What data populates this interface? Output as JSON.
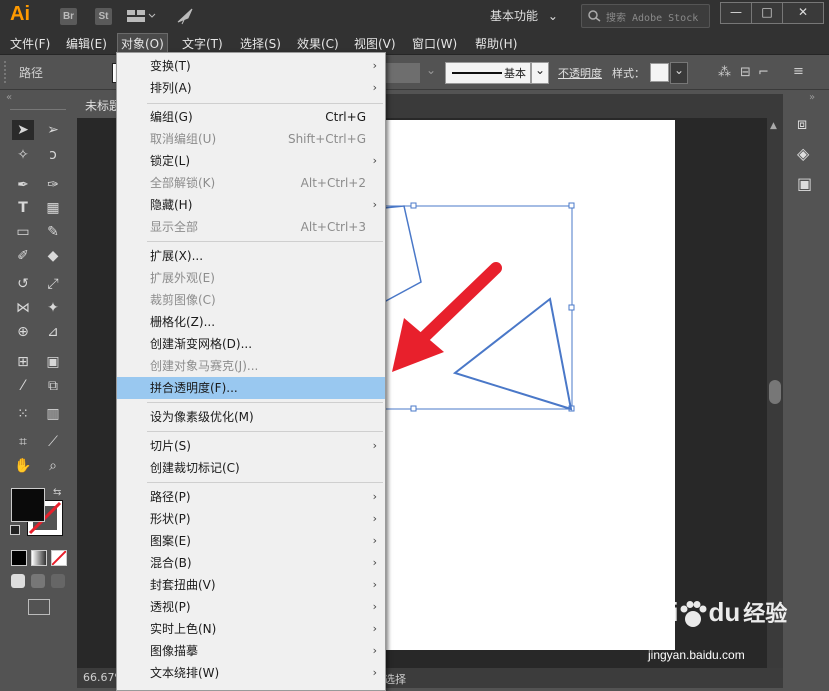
{
  "app": {
    "logo": "Ai",
    "bridge": "Br",
    "stock": "St",
    "workspace": "基本功能",
    "search_placeholder": "搜索 Adobe Stock"
  },
  "window_buttons": [
    "—",
    "□",
    "✕"
  ],
  "menubar": [
    {
      "label": "文件(F)"
    },
    {
      "label": "编辑(E)"
    },
    {
      "label": "对象(O)"
    },
    {
      "label": "文字(T)"
    },
    {
      "label": "选择(S)"
    },
    {
      "label": "效果(C)"
    },
    {
      "label": "视图(V)"
    },
    {
      "label": "窗口(W)"
    },
    {
      "label": "帮助(H)"
    }
  ],
  "control_bar": {
    "selection_type": "路径",
    "stroke_style": "基本",
    "opacity_label": "不透明度",
    "style_label": "样式："
  },
  "document": {
    "tab_title": "未标题",
    "zoom": "66.67%",
    "status_text": "选择"
  },
  "object_menu": {
    "items": [
      {
        "label": "变换(T)",
        "shortcut": "",
        "submenu": true,
        "disabled": false
      },
      {
        "label": "排列(A)",
        "shortcut": "",
        "submenu": true,
        "disabled": false
      },
      {
        "label": "编组(G)",
        "shortcut": "Ctrl+G",
        "submenu": false,
        "disabled": false
      },
      {
        "label": "取消编组(U)",
        "shortcut": "Shift+Ctrl+G",
        "submenu": false,
        "disabled": true
      },
      {
        "label": "锁定(L)",
        "shortcut": "",
        "submenu": true,
        "disabled": false
      },
      {
        "label": "全部解锁(K)",
        "shortcut": "Alt+Ctrl+2",
        "submenu": false,
        "disabled": true
      },
      {
        "label": "隐藏(H)",
        "shortcut": "",
        "submenu": true,
        "disabled": false
      },
      {
        "label": "显示全部",
        "shortcut": "Alt+Ctrl+3",
        "submenu": false,
        "disabled": true
      },
      {
        "label": "扩展(X)...",
        "shortcut": "",
        "submenu": false,
        "disabled": false
      },
      {
        "label": "扩展外观(E)",
        "shortcut": "",
        "submenu": false,
        "disabled": true
      },
      {
        "label": "裁剪图像(C)",
        "shortcut": "",
        "submenu": false,
        "disabled": true
      },
      {
        "label": "栅格化(Z)...",
        "shortcut": "",
        "submenu": false,
        "disabled": false
      },
      {
        "label": "创建渐变网格(D)...",
        "shortcut": "",
        "submenu": false,
        "disabled": false
      },
      {
        "label": "创建对象马赛克(J)...",
        "shortcut": "",
        "submenu": false,
        "disabled": true
      },
      {
        "label": "拼合透明度(F)...",
        "shortcut": "",
        "submenu": false,
        "disabled": false,
        "highlighted": true
      },
      {
        "label": "设为像素级优化(M)",
        "shortcut": "",
        "submenu": false,
        "disabled": false
      },
      {
        "label": "切片(S)",
        "shortcut": "",
        "submenu": true,
        "disabled": false
      },
      {
        "label": "创建裁切标记(C)",
        "shortcut": "",
        "submenu": false,
        "disabled": false
      },
      {
        "label": "路径(P)",
        "shortcut": "",
        "submenu": true,
        "disabled": false
      },
      {
        "label": "形状(P)",
        "shortcut": "",
        "submenu": true,
        "disabled": false
      },
      {
        "label": "图案(E)",
        "shortcut": "",
        "submenu": true,
        "disabled": false
      },
      {
        "label": "混合(B)",
        "shortcut": "",
        "submenu": true,
        "disabled": false
      },
      {
        "label": "封套扭曲(V)",
        "shortcut": "",
        "submenu": true,
        "disabled": false
      },
      {
        "label": "透视(P)",
        "shortcut": "",
        "submenu": true,
        "disabled": false
      },
      {
        "label": "实时上色(N)",
        "shortcut": "",
        "submenu": true,
        "disabled": false
      },
      {
        "label": "图像描摹",
        "shortcut": "",
        "submenu": true,
        "disabled": false
      },
      {
        "label": "文本绕排(W)",
        "shortcut": "",
        "submenu": true,
        "disabled": false
      }
    ],
    "submenu_arrow": "›"
  },
  "watermark": {
    "brand": "Bai",
    "brand2": "du",
    "site_cn": "经验",
    "url": "jingyan.baidu.com"
  },
  "colors": {
    "highlight": "#99c8f0",
    "shape_stroke": "#4a78c8",
    "arrow": "#e8202c",
    "logo": "#ff9a00"
  }
}
